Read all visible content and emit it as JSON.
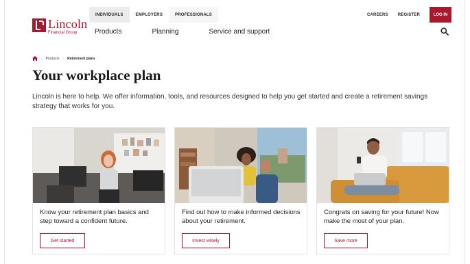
{
  "header": {
    "logo": {
      "name": "Lincoln",
      "subtitle": "Financial Group"
    },
    "audience_tabs": [
      "INDIVIDUALS",
      "EMPLOYERS",
      "PROFESSIONALS"
    ],
    "utility_links": {
      "careers": "CAREERS",
      "register": "REGISTER",
      "login": "LOG IN"
    },
    "main_nav": [
      "Products",
      "Planning",
      "Service and support"
    ]
  },
  "breadcrumb": {
    "level1": "Products",
    "current": "Retirement plans"
  },
  "page": {
    "title": "Your workplace plan",
    "intro": "Lincoln is here to help. We offer information, tools, and resources designed to help you get started and create a retirement savings strategy that works for you."
  },
  "cards": [
    {
      "text": "Know your retirement plan basics and step toward a confident future.",
      "button": "Get started"
    },
    {
      "text": "Find out how to make informed decisions about your retirement.",
      "button": "Invest wisely"
    },
    {
      "text": "Congrats on saving for your future! Now make the most of your plan.",
      "button": "Save more"
    }
  ],
  "colors": {
    "brand": "#a6192e"
  }
}
